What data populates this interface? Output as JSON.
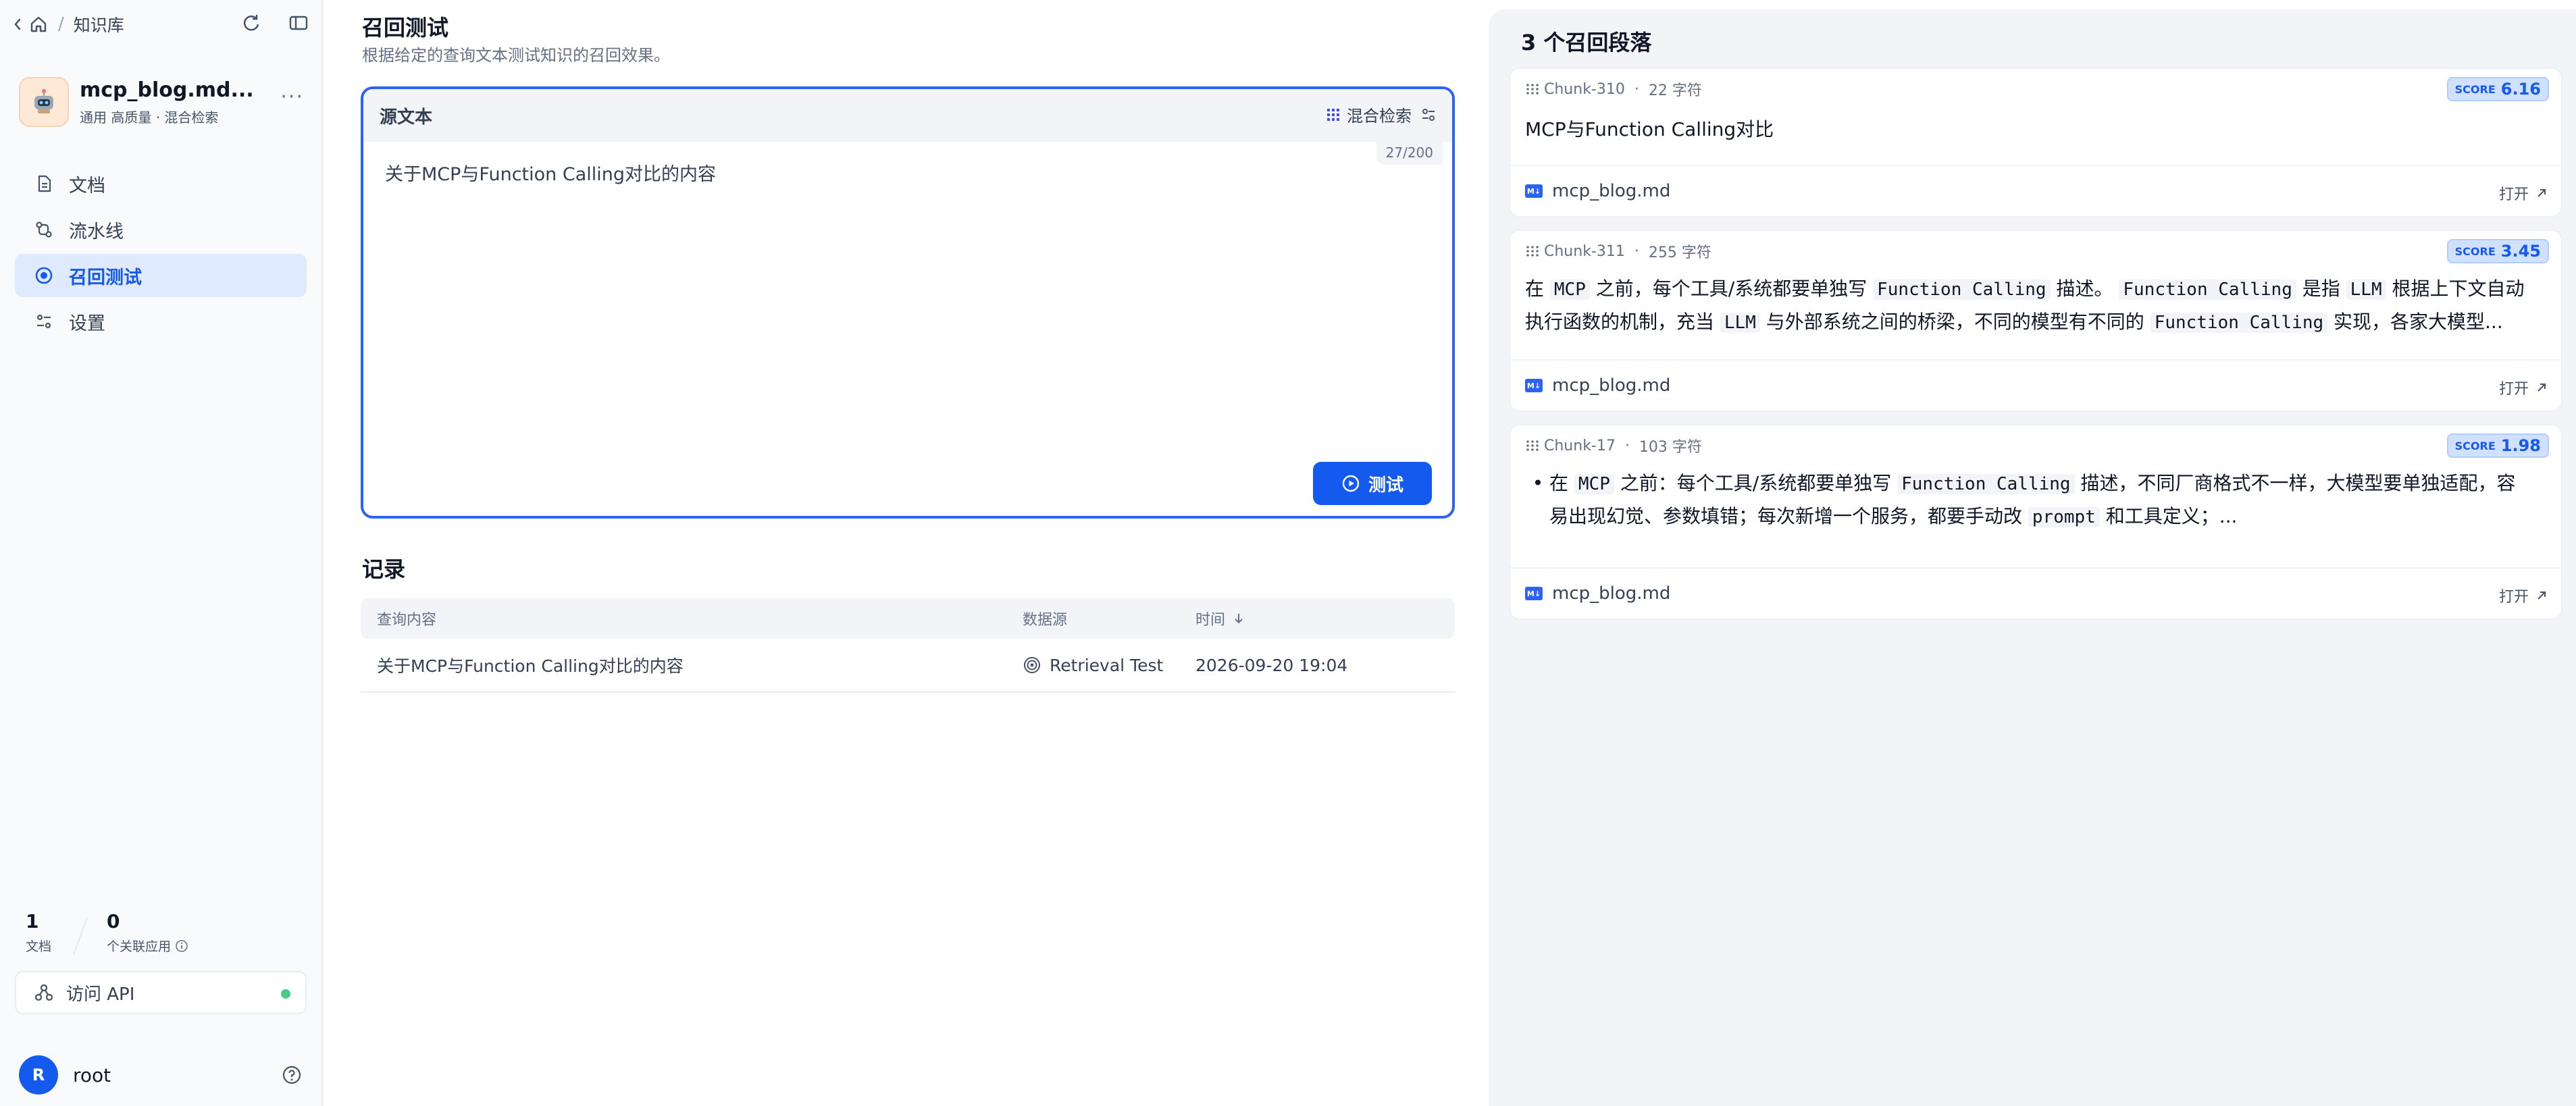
{
  "breadcrumb": {
    "section": "知识库"
  },
  "dataset": {
    "name": "mcp_blog.md...",
    "meta": "通用  高质量 · 混合检索"
  },
  "menu": [
    {
      "label": "文档",
      "icon": "document-icon"
    },
    {
      "label": "流水线",
      "icon": "pipeline-icon"
    },
    {
      "label": "召回测试",
      "icon": "target-icon"
    },
    {
      "label": "设置",
      "icon": "settings-icon"
    }
  ],
  "stats": {
    "docs": {
      "value": "1",
      "label": "文档"
    },
    "apps": {
      "value": "0",
      "label": "个关联应用"
    }
  },
  "api": {
    "label": "访问 API"
  },
  "user": {
    "initial": "R",
    "name": "root"
  },
  "page": {
    "title": "召回测试",
    "subtitle": "根据给定的查询文本测试知识的召回效果。"
  },
  "source": {
    "label": "源文本",
    "mode": "混合检索",
    "counter": "27/200",
    "query": "关于MCP与Function Calling对比的内容",
    "test_button": "测试"
  },
  "records": {
    "title": "记录",
    "columns": [
      "查询内容",
      "数据源",
      "时间"
    ],
    "rows": [
      {
        "query": "关于MCP与Function Calling对比的内容",
        "source": "Retrieval Test",
        "time": "2026-09-20 19:04"
      }
    ]
  },
  "results": {
    "title": "3 个召回段落",
    "score_label": "SCORE",
    "open_label": "打开",
    "chunks": [
      {
        "id": "Chunk-310",
        "chars": "22 字符",
        "score": "6.16",
        "file": "mcp_blog.md"
      },
      {
        "id": "Chunk-311",
        "chars": "255 字符",
        "score": "3.45",
        "file": "mcp_blog.md"
      },
      {
        "id": "Chunk-17",
        "chars": "103 字符",
        "score": "1.98",
        "file": "mcp_blog.md"
      }
    ],
    "chunk1_text": "MCP与Function Calling对比",
    "chunk2": {
      "t1": "在 ",
      "c1": "MCP",
      "t2": " 之前，每个工具/系统都要单独写 ",
      "c2": "Function Calling",
      "t3": " 描述。 ",
      "c3": "Function Calling",
      "t4": " 是指 ",
      "c4": "LLM",
      "t5": " 根据上下文自动执行函数的机制，充当 ",
      "c5": "LLM",
      "t6": " 与外部系统之间的桥梁，不同的模型有不同的 ",
      "c6": "Function Calling",
      "t7": " 实现，各家大模型..."
    },
    "chunk3": {
      "t1": "在 ",
      "c1": "MCP",
      "t2": " 之前：每个工具/系统都要单独写 ",
      "c2": "Function Calling",
      "t3": " 描述，不同厂商格式不一样，大模型要单独适配，容易出现幻觉、参数填错；每次新增一个服务，都要手动改 ",
      "c3": "prompt",
      "t4": " 和工具定义；..."
    }
  },
  "colors": {
    "accent": "#155aef",
    "status_online": "#47cd89"
  }
}
